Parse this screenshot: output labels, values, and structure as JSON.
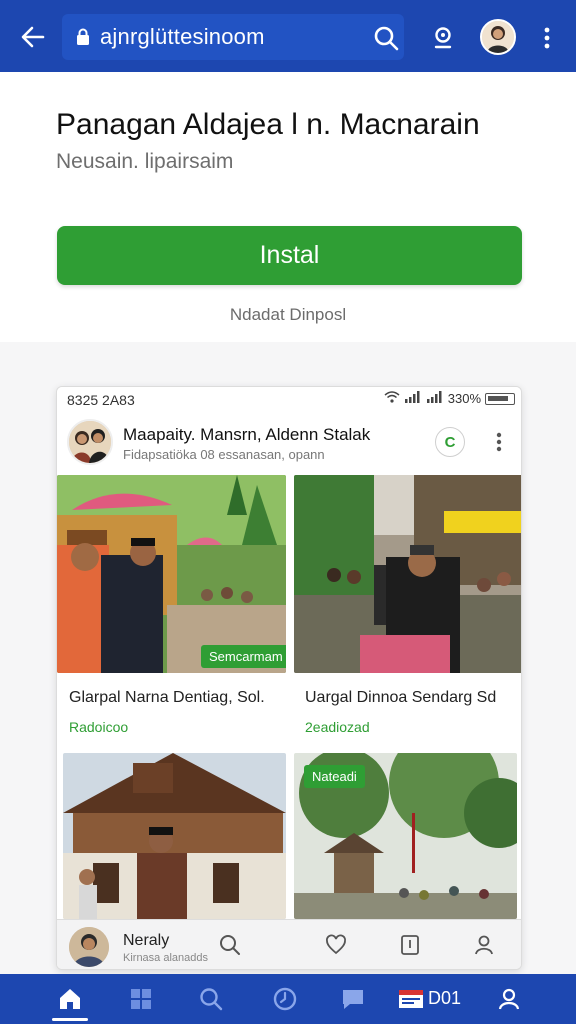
{
  "browser": {
    "url": "ajnrglüttesinoom",
    "colors": {
      "bar": "#1d47b0",
      "url_field": "#2253c3"
    }
  },
  "app": {
    "title": "Panagan Aldajea l n. Macnarain",
    "subtitle": "Neusain. lipairsaim",
    "install_label": "Instal",
    "install_note": "Ndadat Dinposl",
    "accent": "#2f9e34"
  },
  "preview": {
    "status": {
      "time": "8325 2A83",
      "battery": "330%"
    },
    "profile": {
      "name": "Maapaity. Mansrn, Aldenn Stalak",
      "subtitle": "Fidapsatiöka 08 essanasan, opann",
      "action_letter": "C"
    },
    "tiles": [
      {
        "badge": "Semcarmam",
        "caption": "Glarpal Narna Dentiag, Sol.",
        "meta": "Radoicoo"
      },
      {
        "badge": "",
        "caption": "Uargal Dinnoa Sendarg Sd",
        "meta": "2eadiozad"
      },
      {
        "badge": "",
        "caption": "",
        "meta": ""
      },
      {
        "badge": "Nateadi",
        "caption": "",
        "meta": ""
      }
    ],
    "inner_nav": {
      "label": "Neraly",
      "sub": "Kirnasa alanadds"
    }
  },
  "bottom_nav": {
    "count_label": "D01",
    "items": [
      "home-icon",
      "grid-icon",
      "search-icon",
      "clock-icon",
      "chat-icon",
      "inbox-icon",
      "profile-icon"
    ]
  }
}
